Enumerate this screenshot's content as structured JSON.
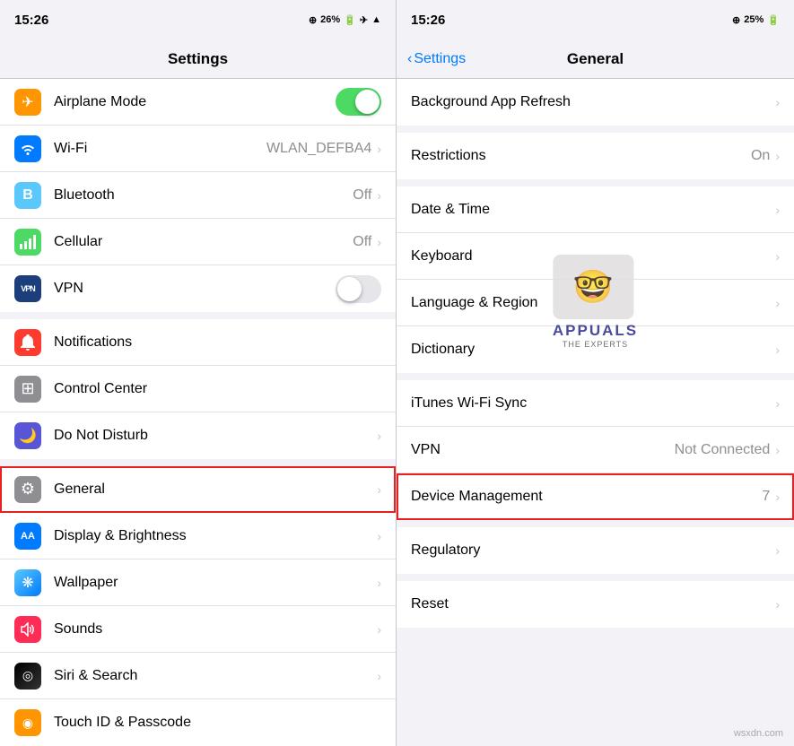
{
  "left": {
    "statusBar": {
      "time": "15:26",
      "battery": "26%",
      "icons": [
        "wifi",
        "airplane",
        "signal"
      ]
    },
    "navTitle": "Settings",
    "sections": [
      {
        "rows": [
          {
            "id": "airplane",
            "icon": "✈",
            "iconClass": "icon-orange",
            "label": "Airplane Mode",
            "value": "",
            "hasToggle": true,
            "toggleOn": true,
            "hasChevron": false
          },
          {
            "id": "wifi",
            "icon": "📶",
            "iconClass": "icon-blue",
            "label": "Wi-Fi",
            "value": "WLAN_DEFBA4",
            "hasToggle": false,
            "toggleOn": false,
            "hasChevron": true
          },
          {
            "id": "bluetooth",
            "icon": "🔷",
            "iconClass": "icon-blue-light",
            "label": "Bluetooth",
            "value": "Off",
            "hasToggle": false,
            "toggleOn": false,
            "hasChevron": true
          },
          {
            "id": "cellular",
            "icon": "📡",
            "iconClass": "icon-green",
            "label": "Cellular",
            "value": "Off",
            "hasToggle": false,
            "toggleOn": false,
            "hasChevron": true
          },
          {
            "id": "vpn",
            "icon": "VPN",
            "iconClass": "icon-blue-dark",
            "label": "VPN",
            "value": "",
            "hasToggle": true,
            "toggleOn": false,
            "hasChevron": false
          }
        ]
      },
      {
        "rows": [
          {
            "id": "notifications",
            "icon": "🔔",
            "iconClass": "icon-red",
            "label": "Notifications",
            "value": "",
            "hasToggle": false,
            "toggleOn": false,
            "hasChevron": false
          },
          {
            "id": "control-center",
            "icon": "⊞",
            "iconClass": "icon-gray",
            "label": "Control Center",
            "value": "",
            "hasToggle": false,
            "toggleOn": false,
            "hasChevron": false
          },
          {
            "id": "do-not-disturb",
            "icon": "🌙",
            "iconClass": "icon-purple",
            "label": "Do Not Disturb",
            "value": "",
            "hasToggle": false,
            "toggleOn": false,
            "hasChevron": true
          }
        ]
      },
      {
        "rows": [
          {
            "id": "general",
            "icon": "⚙",
            "iconClass": "icon-gray",
            "label": "General",
            "value": "",
            "hasToggle": false,
            "toggleOn": false,
            "hasChevron": true,
            "highlighted": true
          },
          {
            "id": "display",
            "icon": "AA",
            "iconClass": "icon-blue",
            "label": "Display & Brightness",
            "value": "",
            "hasToggle": false,
            "toggleOn": false,
            "hasChevron": true
          },
          {
            "id": "wallpaper",
            "icon": "❋",
            "iconClass": "icon-teal",
            "label": "Wallpaper",
            "value": "",
            "hasToggle": false,
            "toggleOn": false,
            "hasChevron": true
          },
          {
            "id": "sounds",
            "icon": "🔊",
            "iconClass": "icon-pink",
            "label": "Sounds",
            "value": "",
            "hasToggle": false,
            "toggleOn": false,
            "hasChevron": true
          },
          {
            "id": "siri",
            "icon": "◎",
            "iconClass": "icon-dark",
            "label": "Siri & Search",
            "value": "",
            "hasToggle": false,
            "toggleOn": false,
            "hasChevron": true
          },
          {
            "id": "touchid",
            "icon": "◉",
            "iconClass": "icon-orange",
            "label": "Touch ID & Passcode",
            "value": "",
            "hasToggle": false,
            "toggleOn": false,
            "hasChevron": false
          }
        ]
      }
    ]
  },
  "right": {
    "statusBar": {
      "time": "15:26",
      "battery": "25%"
    },
    "navTitle": "General",
    "navBack": "Settings",
    "sections": [
      {
        "rows": [
          {
            "id": "bg-refresh",
            "label": "Background App Refresh",
            "value": "",
            "hasChevron": true,
            "highlighted": false
          }
        ]
      },
      {
        "rows": [
          {
            "id": "restrictions",
            "label": "Restrictions",
            "value": "On",
            "hasChevron": true,
            "highlighted": false
          }
        ]
      },
      {
        "rows": [
          {
            "id": "date-time",
            "label": "Date & Time",
            "value": "",
            "hasChevron": true,
            "highlighted": false
          },
          {
            "id": "keyboard",
            "label": "Keyboard",
            "value": "",
            "hasChevron": true,
            "highlighted": false
          },
          {
            "id": "language",
            "label": "Language & Region",
            "value": "",
            "hasChevron": true,
            "highlighted": false
          },
          {
            "id": "dictionary",
            "label": "Dictionary",
            "value": "",
            "hasChevron": true,
            "highlighted": false
          }
        ]
      },
      {
        "rows": [
          {
            "id": "itunes-wifi",
            "label": "iTunes Wi-Fi Sync",
            "value": "",
            "hasChevron": true,
            "highlighted": false
          },
          {
            "id": "vpn-right",
            "label": "VPN",
            "value": "Not Connected",
            "hasChevron": true,
            "highlighted": false
          },
          {
            "id": "device-mgmt",
            "label": "Device Management",
            "value": "7",
            "hasChevron": true,
            "highlighted": true
          }
        ]
      },
      {
        "rows": [
          {
            "id": "regulatory",
            "label": "Regulatory",
            "value": "",
            "hasChevron": true,
            "highlighted": false
          }
        ]
      },
      {
        "rows": [
          {
            "id": "reset",
            "label": "Reset",
            "value": "",
            "hasChevron": true,
            "highlighted": false
          }
        ]
      }
    ]
  },
  "watermark": {
    "brand": "APPUALS",
    "sub": "THE EXPERTS"
  },
  "bottomWatermark": "wsxdn.com"
}
